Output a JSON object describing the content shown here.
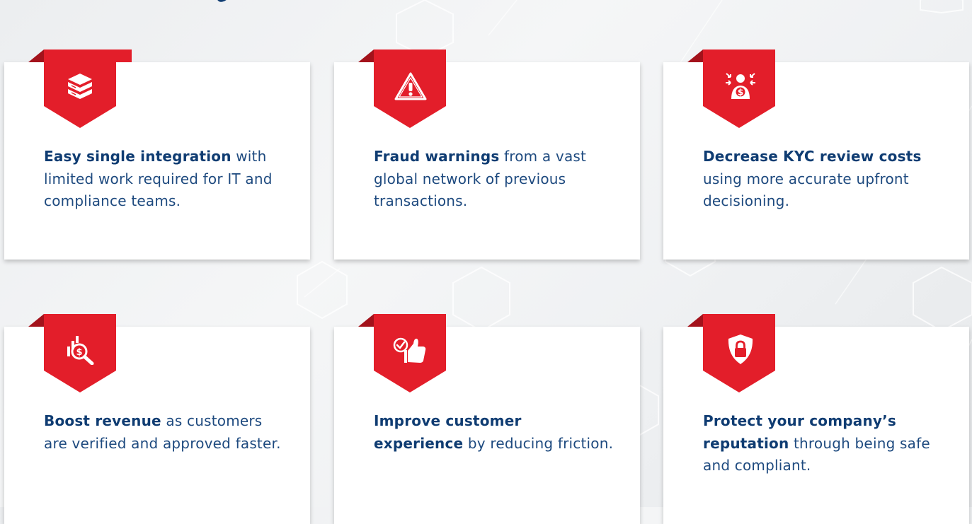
{
  "colors": {
    "accent": "#e31e2a",
    "accent_dark": "#a3121b",
    "text": "#1e4a7f",
    "highlight": "#0f3c72"
  },
  "cards": [
    {
      "icon": "server-stack-icon",
      "highlight": "Easy single integration",
      "rest": "with limited work required for IT and compliance teams."
    },
    {
      "icon": "warning-triangle-icon",
      "highlight": "Fraud warnings",
      "rest": "from a vast global network of previous transactions."
    },
    {
      "icon": "person-dollar-icon",
      "highlight": "Decrease KYC review costs",
      "rest": "using more accurate upfront decisioning."
    },
    {
      "icon": "revenue-search-icon",
      "highlight": "Boost revenue",
      "rest": "as customers are verified and approved faster."
    },
    {
      "icon": "thumbs-up-check-icon",
      "highlight": "Improve customer experience",
      "rest": "by reducing friction."
    },
    {
      "icon": "shield-lock-icon",
      "highlight": "Protect your company’s reputation",
      "rest": "through being safe and compliant."
    }
  ]
}
